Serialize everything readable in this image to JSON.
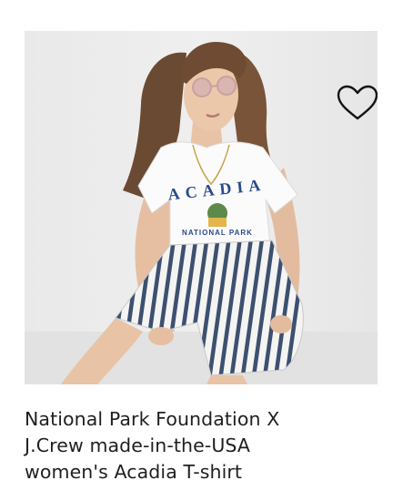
{
  "product": {
    "title_lines": [
      "National Park Foundation X",
      "J.Crew made-in-the-USA",
      "women's Acadia T-shirt"
    ],
    "image_icon": "product-photo",
    "shirt_print": {
      "top": "ACADIA",
      "bottom": "NATIONAL PARK"
    },
    "wishlist_icon": "heart-outline-icon"
  },
  "colors": {
    "image_background": "#ececec",
    "text": "#1f1f1f",
    "print_blue": "#2a4a8e",
    "stripe_blue": "#3d5070"
  }
}
